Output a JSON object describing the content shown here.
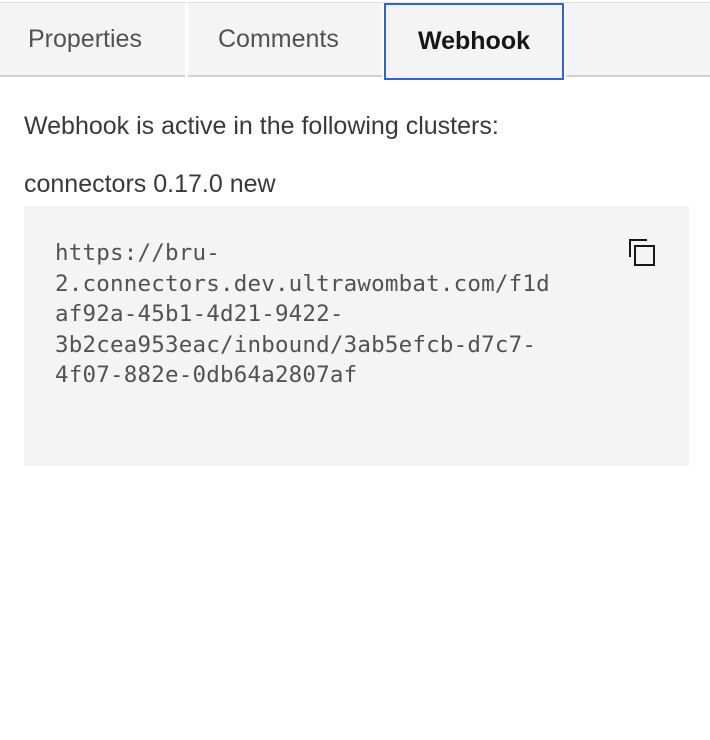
{
  "tabs": [
    {
      "label": "Properties",
      "active": false
    },
    {
      "label": "Comments",
      "active": false
    },
    {
      "label": "Webhook",
      "active": true
    }
  ],
  "webhook": {
    "description": "Webhook is active in the following clusters:",
    "cluster": "connectors 0.17.0 new",
    "url_lines": [
      "https://bru-",
      "2.connectors.dev.ultrawombat.com/f1d",
      "af92a-45b1-4d21-9422-",
      "3b2cea953eac/inbound/3ab5efcb-d7c7-",
      "4f07-882e-0db64a2807af"
    ],
    "copy_icon": "copy-icon"
  },
  "colors": {
    "active_tab_border": "#2f64d8",
    "tab_background": "#f4f4f4",
    "code_background": "#f4f4f4"
  }
}
